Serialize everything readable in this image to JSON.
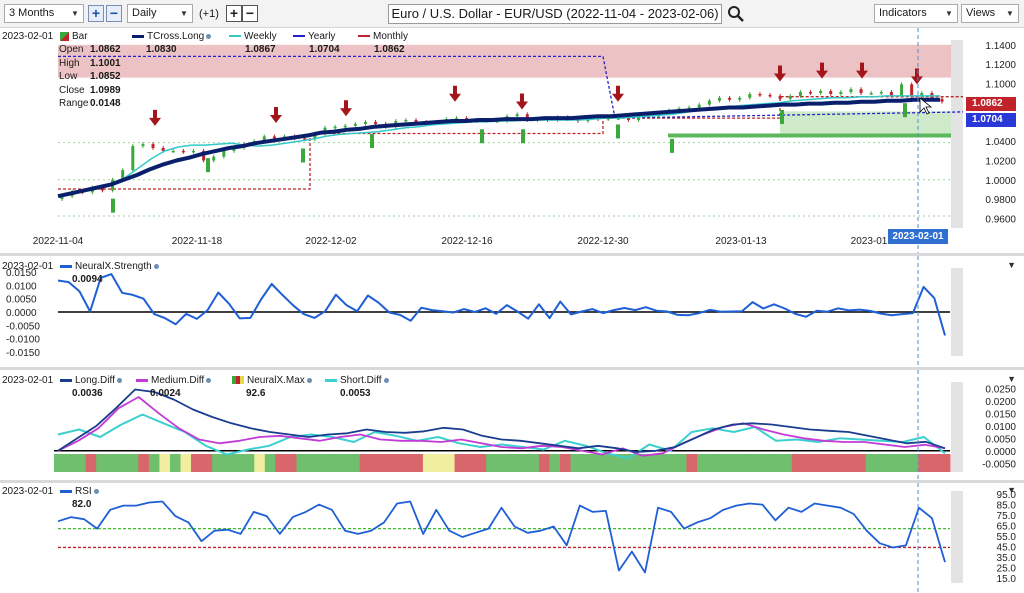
{
  "toolbar": {
    "range_select": "3 Months",
    "interval_select": "Daily",
    "offset": "(+1)",
    "title": "Euro / U.S. Dollar - EUR/USD (2022-11-04 - 2023-02-06)",
    "indicators_label": "Indicators",
    "views_label": "Views",
    "icons": {
      "search": "search-icon",
      "add": "plus-icon",
      "remove": "minus-icon",
      "dropdown": "chevron-down-icon"
    }
  },
  "price_panel": {
    "date": "2023-02-01",
    "legend": [
      {
        "name": "Bar",
        "value": ""
      },
      {
        "name": "TCross.Long",
        "value": "1.0830"
      },
      {
        "name": "Weekly",
        "value": "1.0867"
      },
      {
        "name": "Yearly",
        "value": "1.0704"
      },
      {
        "name": "Monthly",
        "value": "1.0862"
      }
    ],
    "ohlc": [
      {
        "label": "Open",
        "value": "1.0862"
      },
      {
        "label": "High",
        "value": "1.1001"
      },
      {
        "label": "Low",
        "value": "1.0852"
      },
      {
        "label": "Close",
        "value": "1.0989"
      },
      {
        "label": "Range",
        "value": "0.0148"
      }
    ],
    "price_tags": {
      "red": "1.0862",
      "blue": "1.0704"
    },
    "cursor_date": "2023-02-01"
  },
  "strength_panel": {
    "date": "2023-02-01",
    "name": "NeuralX.Strength",
    "value": "0.0094"
  },
  "diff_panel": {
    "date": "2023-02-01",
    "legend": [
      {
        "name": "Long.Diff",
        "value": "0.0036"
      },
      {
        "name": "Medium.Diff",
        "value": "0.0024"
      },
      {
        "name": "NeuralX.Max",
        "value": "92.6"
      },
      {
        "name": "Short.Diff",
        "value": "0.0053"
      }
    ]
  },
  "rsi_panel": {
    "date": "2023-02-01",
    "name": "RSI",
    "value": "82.0"
  },
  "colors": {
    "bull": "#3aa83a",
    "bear": "#c0242a",
    "tcross": "#0a1f6b",
    "weekly": "#33c9c9",
    "yearly": "#2222cc",
    "monthly": "#c0242a",
    "strength": "#1f5fd6",
    "long_diff": "#1a3d8f",
    "medium_diff": "#c23bd6",
    "short_diff": "#3ccfcf",
    "rsi": "#1f5fd6",
    "band_green": "#6fbf6f",
    "band_red": "#d9666b",
    "band_yellow": "#f2eea0"
  },
  "chart_data": [
    {
      "type": "candlestick",
      "xlabel": "",
      "ylabel": "",
      "x_ticks": [
        "2022-11-04",
        "2022-11-18",
        "2022-12-02",
        "2022-12-16",
        "2022-12-30",
        "2023-01-13",
        "2023-01"
      ],
      "y_ticks": [
        "1.1400",
        "1.1200",
        "1.1000",
        "1.0800",
        "1.0600",
        "1.0400",
        "1.0200",
        "1.0000",
        "0.9800",
        "0.9600"
      ],
      "ylim": [
        0.95,
        1.145
      ],
      "close": [
        0.983,
        0.988,
        0.987,
        0.992,
        0.989,
        1.0,
        1.01,
        1.035,
        1.037,
        1.033,
        1.03,
        1.03,
        1.029,
        1.03,
        1.02,
        1.024,
        1.03,
        1.033,
        1.037,
        1.04,
        1.045,
        1.043,
        1.045,
        1.043,
        1.042,
        1.048,
        1.054,
        1.055,
        1.056,
        1.058,
        1.06,
        1.058,
        1.055,
        1.061,
        1.062,
        1.06,
        1.059,
        1.06,
        1.063,
        1.064,
        1.062,
        1.061,
        1.061,
        1.061,
        1.066,
        1.068,
        1.062,
        1.063,
        1.062,
        1.065,
        1.063,
        1.061,
        1.065,
        1.063,
        1.064,
        1.064,
        1.062,
        1.067,
        1.066,
        1.069,
        1.072,
        1.074,
        1.075,
        1.078,
        1.082,
        1.085,
        1.083,
        1.085,
        1.089,
        1.088,
        1.087,
        1.084,
        1.087,
        1.091,
        1.09,
        1.092,
        1.089,
        1.091,
        1.094,
        1.09,
        1.09,
        1.091,
        1.087,
        1.099,
        1.087,
        1.09,
        1.084,
        1.081
      ],
      "tcross_long": [
        0.983,
        0.986,
        0.989,
        0.992,
        0.995,
        1.0,
        1.005,
        1.011,
        1.016,
        1.02,
        1.023,
        1.027,
        1.03,
        1.033,
        1.035,
        1.038,
        1.04,
        1.042,
        1.044,
        1.046,
        1.049,
        1.05,
        1.052,
        1.053,
        1.055,
        1.056,
        1.057,
        1.058,
        1.059,
        1.06,
        1.061,
        1.061,
        1.062,
        1.062,
        1.063,
        1.063,
        1.063,
        1.064,
        1.064,
        1.064,
        1.065,
        1.066,
        1.066,
        1.067,
        1.068,
        1.069,
        1.07,
        1.071,
        1.072,
        1.073,
        1.074,
        1.075,
        1.075,
        1.076,
        1.077,
        1.078,
        1.078,
        1.079,
        1.079,
        1.08,
        1.08,
        1.081,
        1.081,
        1.082,
        1.082,
        1.083,
        1.083,
        1.083
      ],
      "weekly": [
        0.983,
        0.987,
        0.99,
        0.993,
        0.996,
        1.002,
        1.012,
        1.022,
        1.03,
        1.034,
        1.036,
        1.036,
        1.037,
        1.038,
        1.036,
        1.035,
        1.036,
        1.038,
        1.04,
        1.042,
        1.045,
        1.047,
        1.048,
        1.049,
        1.05,
        1.052,
        1.054,
        1.055,
        1.057,
        1.058,
        1.059,
        1.06,
        1.06,
        1.061,
        1.061,
        1.062,
        1.062,
        1.062,
        1.062,
        1.062,
        1.063,
        1.064,
        1.064,
        1.065,
        1.066,
        1.067,
        1.068,
        1.07,
        1.072,
        1.074,
        1.075,
        1.077,
        1.078,
        1.079,
        1.08,
        1.082,
        1.083,
        1.084,
        1.085,
        1.085,
        1.086,
        1.086,
        1.087,
        1.087,
        1.087,
        1.087,
        1.087
      ],
      "yearly_level": 1.0704,
      "monthly_level": 1.0862,
      "red_box": [
        1.106,
        1.14
      ],
      "green_box": [
        1.046,
        1.071
      ]
    },
    {
      "type": "line",
      "y_ticks": [
        "0.0150",
        "0.0100",
        "0.0050",
        "0.0000",
        "-0.0050",
        "-0.0100",
        "-0.0150"
      ],
      "ylim": [
        -0.0165,
        0.0165
      ],
      "series": [
        {
          "values": [
            0.0118,
            0.0112,
            0.0078,
            0.0002,
            0.0128,
            0.0142,
            0.0072,
            0.0064,
            0.005,
            -0.0008,
            -0.0023,
            -0.0046,
            -0.0007,
            -0.0026,
            0.0007,
            0.0073,
            0.0031,
            -0.0024,
            -0.0022,
            0.0047,
            0.0105,
            0.0064,
            0.0025,
            -0.0008,
            -0.0022,
            0.0003,
            0.0065,
            0.0026,
            0.0003,
            0.0062,
            0.0035,
            -0.0002,
            -0.0011,
            -0.0033,
            0.0016,
            0.0007,
            0.0003,
            -0.0002,
            0.0011,
            0.0,
            0.0014,
            -0.0007,
            0.0026,
            0.0002,
            -0.0025,
            0.0029,
            -0.0023,
            0.0039,
            -0.0009,
            0.0002,
            0.0011,
            -0.0004,
            0.0007,
            0.0015,
            0.0007,
            0.0018,
            0.0005,
            0.0002,
            -0.0011,
            -0.0012,
            -0.0004,
            0.0008,
            0.0001,
            0.0002,
            0.0003,
            0.0037,
            0.0013,
            0.0029,
            0.0013,
            -0.0007,
            -0.0018,
            0.0005,
            0.0001,
            0.0014,
            0.0006,
            0.0009,
            0.0004,
            -0.0006,
            -0.0012,
            -0.0008,
            -0.0004,
            0.0094,
            0.0052,
            -0.0088
          ]
        }
      ]
    },
    {
      "type": "line",
      "y_ticks": [
        "0.0250",
        "0.0200",
        "0.0150",
        "0.0100",
        "0.0050",
        "0.0000",
        "-0.0050"
      ],
      "ylim": [
        -0.0085,
        0.0275
      ],
      "series": [
        {
          "name": "Long.Diff",
          "values": [
            0.0,
            0.005,
            0.01,
            0.017,
            0.0245,
            0.0235,
            0.0205,
            0.0165,
            0.0135,
            0.011,
            0.009,
            0.0075,
            0.0065,
            0.0055,
            0.0065,
            0.007,
            0.0085,
            0.0075,
            0.0072,
            0.0078,
            0.0092,
            0.0085,
            0.006,
            0.0045,
            0.004,
            0.003,
            0.002,
            0.001,
            0.002,
            0.001,
            -0.0005,
            0.0,
            0.0015,
            0.005,
            0.0085,
            0.0105,
            0.011,
            0.0105,
            0.0095,
            0.0085,
            0.008,
            0.0075,
            0.006,
            0.0045,
            0.003,
            0.0036,
            0.001
          ]
        },
        {
          "name": "Medium.Diff",
          "values": [
            0.0,
            0.004,
            0.009,
            0.017,
            0.0215,
            0.015,
            0.009,
            0.0045,
            0.003,
            0.004,
            0.0055,
            0.006,
            0.005,
            0.004,
            0.0055,
            0.0065,
            0.0045,
            0.004,
            0.004,
            0.0035,
            0.0045,
            0.003,
            0.0015,
            0.001,
            0.002,
            0.0015,
            0.0,
            -0.0015,
            0.001,
            -0.002,
            -0.001,
            0.003,
            0.0065,
            0.0095,
            0.011,
            0.0085,
            0.0065,
            0.005,
            0.004,
            0.0035,
            0.0035,
            0.0025,
            0.0015,
            0.0024,
            0.001
          ]
        },
        {
          "name": "Short.Diff",
          "values": [
            0.0065,
            0.0085,
            0.0055,
            0.0105,
            0.0145,
            0.011,
            0.0075,
            0.002,
            -0.0015,
            0.0005,
            0.002,
            0.0055,
            0.0065,
            0.0055,
            0.0035,
            0.0075,
            0.006,
            0.004,
            0.0055,
            0.003,
            0.0015,
            0.0025,
            0.0015,
            0.0005,
            0.004,
            0.002,
            -0.001,
            -0.003,
            0.0025,
            0.0,
            0.0075,
            0.009,
            0.0075,
            0.0095,
            0.004,
            0.0045,
            0.0035,
            0.005,
            0.0045,
            0.004,
            0.0035,
            0.0055,
            -0.001
          ]
        }
      ],
      "neuralx_max_bands": [
        "green",
        "green",
        "green",
        "red",
        "green",
        "green",
        "green",
        "green",
        "red",
        "green",
        "yellow",
        "green",
        "yellow",
        "red",
        "red",
        "green",
        "green",
        "green",
        "green",
        "yellow",
        "green",
        "red",
        "red",
        "green",
        "green",
        "green",
        "green",
        "green",
        "green",
        "red",
        "red",
        "red",
        "red",
        "red",
        "red",
        "yellow",
        "yellow",
        "yellow",
        "red",
        "red",
        "red",
        "green",
        "green",
        "green",
        "green",
        "green",
        "red",
        "green",
        "red",
        "green",
        "green",
        "green",
        "green",
        "green",
        "green",
        "green",
        "green",
        "green",
        "green",
        "green",
        "red",
        "green",
        "green",
        "green",
        "green",
        "green",
        "green",
        "green",
        "green",
        "green",
        "red",
        "red",
        "red",
        "red",
        "red",
        "red",
        "red",
        "green",
        "green",
        "green",
        "green",
        "green",
        "red",
        "red",
        "red"
      ]
    },
    {
      "type": "line",
      "y_ticks": [
        "95.0",
        "85.0",
        "75.0",
        "65.0",
        "55.0",
        "45.0",
        "35.0",
        "25.0",
        "15.0"
      ],
      "ylim": [
        10,
        98
      ],
      "series": [
        {
          "name": "RSI",
          "values": [
            69,
            73,
            71,
            62,
            80,
            84,
            84,
            87,
            88,
            74,
            68,
            50,
            60,
            61,
            57,
            78,
            74,
            57,
            73,
            78,
            85,
            80,
            60,
            57,
            60,
            68,
            86,
            88,
            57,
            80,
            60,
            54,
            58,
            62,
            82,
            64,
            58,
            60,
            64,
            46,
            84,
            78,
            79,
            22,
            40,
            20,
            82,
            78,
            62,
            68,
            72,
            80,
            84,
            86,
            85,
            70,
            82,
            78,
            86,
            84,
            82,
            76,
            60,
            48,
            44,
            46,
            82,
            72,
            30
          ]
        }
      ],
      "levels": {
        "green": 62,
        "red": 44
      }
    }
  ]
}
